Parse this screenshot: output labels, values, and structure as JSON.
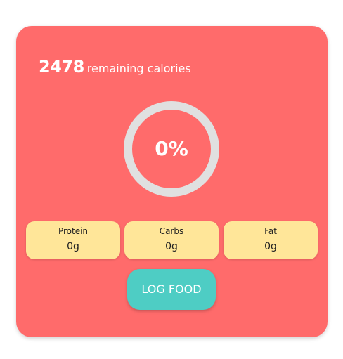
{
  "summary": {
    "remaining_value": "2478",
    "remaining_label": "remaining calories"
  },
  "progress": {
    "percent_label": "0%",
    "percent_value": 0
  },
  "macros": [
    {
      "name": "Protein",
      "value": "0g"
    },
    {
      "name": "Carbs",
      "value": "0g"
    },
    {
      "name": "Fat",
      "value": "0g"
    }
  ],
  "actions": {
    "log_food_label": "LOG FOOD"
  },
  "colors": {
    "card": "#ff6b6b",
    "ring_track": "#e0e0e0",
    "macro_bg": "#ffe699",
    "button": "#4ecdc4"
  }
}
